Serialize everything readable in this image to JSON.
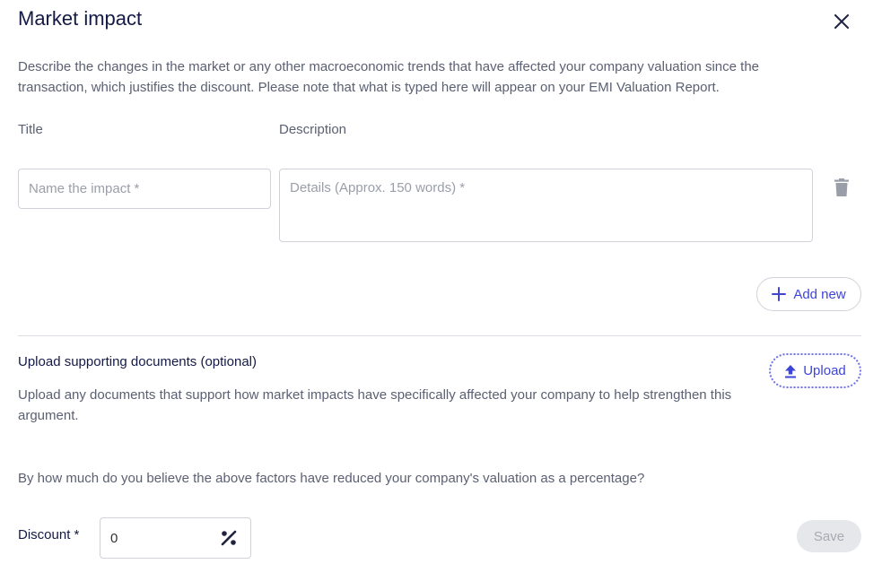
{
  "dialog": {
    "title": "Market impact",
    "intro": "Describe the changes in the market or any other macroeconomic trends that have affected your company valuation since the transaction, which justifies the discount. Please note that what is typed here will appear on your EMI Valuation Report."
  },
  "impact_form": {
    "title_label": "Title",
    "description_label": "Description",
    "title_value": "",
    "title_placeholder": "Name the impact *",
    "description_value": "",
    "description_placeholder": "Details (Approx. 150 words) *",
    "add_new_label": "Add new"
  },
  "upload": {
    "heading": "Upload supporting documents (optional)",
    "description": "Upload any documents that support how market impacts have specifically affected your company to help strengthen this argument.",
    "button_label": "Upload"
  },
  "discount": {
    "question": "By how much do you believe the above factors have reduced your company's valuation as a percentage?",
    "label": "Discount *",
    "value": "0",
    "unit_icon": "percent-icon"
  },
  "actions": {
    "save_label": "Save"
  },
  "icons": {
    "close": "close-icon",
    "trash": "trash-icon",
    "add": "plus-icon",
    "upload": "upload-arrow-icon"
  },
  "colors": {
    "accent": "#3e45d8",
    "heading": "#141a45",
    "body_text": "#5b6072",
    "border": "#cfd2da",
    "disabled_bg": "#e6e7eb"
  }
}
